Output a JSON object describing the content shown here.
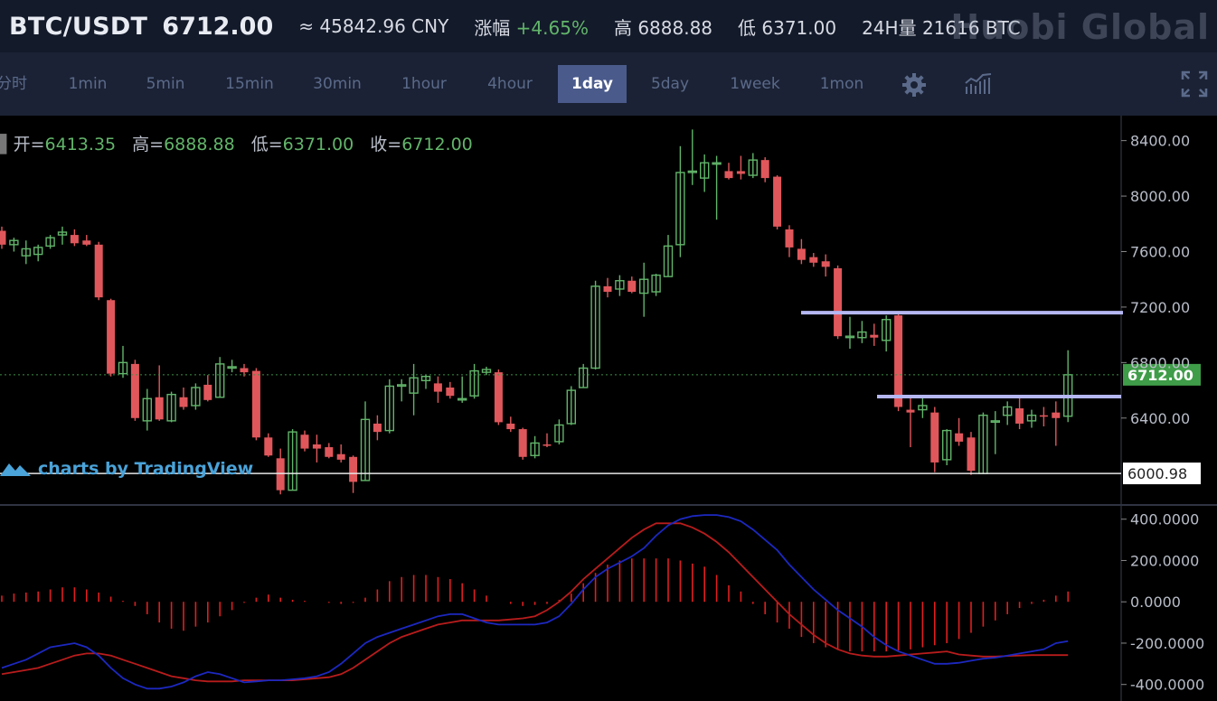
{
  "header": {
    "pair": "BTC/USDT",
    "price": "6712.00",
    "cny_label": "≈ 45842.96 CNY",
    "change_label": "涨幅",
    "change_value": "+4.65%",
    "high_label": "高 6888.88",
    "low_label": "低 6371.00",
    "volume_label": "24H量 21616 BTC",
    "brand": "Huobi Global"
  },
  "toolbar": {
    "timeframes": [
      "分时",
      "1min",
      "5min",
      "15min",
      "30min",
      "1hour",
      "4hour",
      "1day",
      "5day",
      "1week",
      "1mon"
    ],
    "active": "1day",
    "icons": [
      "gear-icon",
      "indicator-icon",
      "fullscreen-icon"
    ]
  },
  "ohlc": {
    "open_label": "开=",
    "open": "6413.35",
    "high_label": "高=",
    "high": "6888.88",
    "low_label": "低=",
    "low": "6371.00",
    "close_label": "收=",
    "close": "6712.00"
  },
  "watermark": "charts by TradingView",
  "colors": {
    "up": "#62b46a",
    "down": "#e0575b",
    "macd_bar": "#e01e1e",
    "dif_line": "#1c28c0",
    "dea_line": "#b81c1c",
    "hline": "#b5b7f2",
    "last_price_bg": "#3f9c48"
  },
  "chart_data": [
    {
      "type": "candlestick",
      "title": "",
      "last_price": 6712.0,
      "last_price_label": "6712.00",
      "marked_level": 6000.98,
      "marked_level_label": "6000.98",
      "horizontal_lines": [
        7160,
        6555
      ],
      "y_ticks": [
        8400,
        8000,
        7600,
        7200,
        6800,
        6400
      ],
      "y_tick_labels": [
        "8400.00",
        "8000.00",
        "7600.00",
        "7200.00",
        "6800.00",
        "6400.00"
      ],
      "ylim": [
        5780,
        8580
      ],
      "candles": [
        {
          "o": 7750,
          "h": 7780,
          "l": 7620,
          "c": 7650
        },
        {
          "o": 7650,
          "h": 7700,
          "l": 7600,
          "c": 7680
        },
        {
          "o": 7570,
          "h": 7680,
          "l": 7510,
          "c": 7620
        },
        {
          "o": 7580,
          "h": 7650,
          "l": 7530,
          "c": 7630
        },
        {
          "o": 7640,
          "h": 7720,
          "l": 7620,
          "c": 7700
        },
        {
          "o": 7720,
          "h": 7780,
          "l": 7650,
          "c": 7740
        },
        {
          "o": 7720,
          "h": 7760,
          "l": 7640,
          "c": 7660
        },
        {
          "o": 7680,
          "h": 7720,
          "l": 7640,
          "c": 7650
        },
        {
          "o": 7650,
          "h": 7670,
          "l": 7250,
          "c": 7270
        },
        {
          "o": 7250,
          "h": 7260,
          "l": 6700,
          "c": 6720
        },
        {
          "o": 6720,
          "h": 6920,
          "l": 6690,
          "c": 6800
        },
        {
          "o": 6790,
          "h": 6820,
          "l": 6380,
          "c": 6400
        },
        {
          "o": 6380,
          "h": 6610,
          "l": 6310,
          "c": 6540
        },
        {
          "o": 6550,
          "h": 6780,
          "l": 6380,
          "c": 6390
        },
        {
          "o": 6380,
          "h": 6590,
          "l": 6370,
          "c": 6570
        },
        {
          "o": 6550,
          "h": 6620,
          "l": 6460,
          "c": 6480
        },
        {
          "o": 6490,
          "h": 6650,
          "l": 6460,
          "c": 6620
        },
        {
          "o": 6640,
          "h": 6710,
          "l": 6520,
          "c": 6530
        },
        {
          "o": 6550,
          "h": 6840,
          "l": 6550,
          "c": 6790
        },
        {
          "o": 6760,
          "h": 6820,
          "l": 6730,
          "c": 6770
        },
        {
          "o": 6760,
          "h": 6790,
          "l": 6700,
          "c": 6730
        },
        {
          "o": 6740,
          "h": 6760,
          "l": 6240,
          "c": 6260
        },
        {
          "o": 6260,
          "h": 6290,
          "l": 6120,
          "c": 6130
        },
        {
          "o": 6110,
          "h": 6180,
          "l": 5850,
          "c": 5880
        },
        {
          "o": 5880,
          "h": 6320,
          "l": 5880,
          "c": 6300
        },
        {
          "o": 6280,
          "h": 6310,
          "l": 6160,
          "c": 6180
        },
        {
          "o": 6210,
          "h": 6280,
          "l": 6080,
          "c": 6180
        },
        {
          "o": 6190,
          "h": 6220,
          "l": 6110,
          "c": 6120
        },
        {
          "o": 6140,
          "h": 6210,
          "l": 6080,
          "c": 6100
        },
        {
          "o": 6120,
          "h": 6130,
          "l": 5860,
          "c": 5940
        },
        {
          "o": 5950,
          "h": 6520,
          "l": 5950,
          "c": 6390
        },
        {
          "o": 6360,
          "h": 6420,
          "l": 6240,
          "c": 6300
        },
        {
          "o": 6310,
          "h": 6680,
          "l": 6290,
          "c": 6630
        },
        {
          "o": 6630,
          "h": 6680,
          "l": 6520,
          "c": 6640
        },
        {
          "o": 6580,
          "h": 6790,
          "l": 6420,
          "c": 6690
        },
        {
          "o": 6670,
          "h": 6710,
          "l": 6610,
          "c": 6700
        },
        {
          "o": 6650,
          "h": 6700,
          "l": 6510,
          "c": 6590
        },
        {
          "o": 6620,
          "h": 6660,
          "l": 6540,
          "c": 6560
        },
        {
          "o": 6540,
          "h": 6700,
          "l": 6510,
          "c": 6540
        },
        {
          "o": 6560,
          "h": 6790,
          "l": 6540,
          "c": 6740
        },
        {
          "o": 6730,
          "h": 6770,
          "l": 6710,
          "c": 6750
        },
        {
          "o": 6730,
          "h": 6750,
          "l": 6350,
          "c": 6370
        },
        {
          "o": 6360,
          "h": 6410,
          "l": 6300,
          "c": 6320
        },
        {
          "o": 6320,
          "h": 6330,
          "l": 6100,
          "c": 6120
        },
        {
          "o": 6130,
          "h": 6270,
          "l": 6110,
          "c": 6220
        },
        {
          "o": 6210,
          "h": 6290,
          "l": 6190,
          "c": 6200
        },
        {
          "o": 6230,
          "h": 6390,
          "l": 6210,
          "c": 6350
        },
        {
          "o": 6360,
          "h": 6630,
          "l": 6350,
          "c": 6600
        },
        {
          "o": 6620,
          "h": 6790,
          "l": 6620,
          "c": 6760
        },
        {
          "o": 6760,
          "h": 7390,
          "l": 6750,
          "c": 7350
        },
        {
          "o": 7350,
          "h": 7410,
          "l": 7270,
          "c": 7310
        },
        {
          "o": 7330,
          "h": 7430,
          "l": 7280,
          "c": 7390
        },
        {
          "o": 7390,
          "h": 7420,
          "l": 7300,
          "c": 7310
        },
        {
          "o": 7300,
          "h": 7520,
          "l": 7130,
          "c": 7400
        },
        {
          "o": 7310,
          "h": 7440,
          "l": 7280,
          "c": 7430
        },
        {
          "o": 7420,
          "h": 7720,
          "l": 7420,
          "c": 7640
        },
        {
          "o": 7650,
          "h": 8360,
          "l": 7560,
          "c": 8170
        },
        {
          "o": 8180,
          "h": 8480,
          "l": 8080,
          "c": 8180
        },
        {
          "o": 8130,
          "h": 8300,
          "l": 8030,
          "c": 8240
        },
        {
          "o": 8240,
          "h": 8290,
          "l": 7830,
          "c": 8240
        },
        {
          "o": 8180,
          "h": 8240,
          "l": 8120,
          "c": 8130
        },
        {
          "o": 8180,
          "h": 8290,
          "l": 8120,
          "c": 8160
        },
        {
          "o": 8150,
          "h": 8310,
          "l": 8130,
          "c": 8260
        },
        {
          "o": 8260,
          "h": 8280,
          "l": 8100,
          "c": 8130
        },
        {
          "o": 8140,
          "h": 8150,
          "l": 7760,
          "c": 7780
        },
        {
          "o": 7760,
          "h": 7790,
          "l": 7560,
          "c": 7630
        },
        {
          "o": 7620,
          "h": 7690,
          "l": 7510,
          "c": 7540
        },
        {
          "o": 7560,
          "h": 7590,
          "l": 7490,
          "c": 7520
        },
        {
          "o": 7530,
          "h": 7580,
          "l": 7420,
          "c": 7490
        },
        {
          "o": 7480,
          "h": 7500,
          "l": 6970,
          "c": 6990
        },
        {
          "o": 6990,
          "h": 7130,
          "l": 6900,
          "c": 6990
        },
        {
          "o": 6980,
          "h": 7100,
          "l": 6940,
          "c": 7020
        },
        {
          "o": 7000,
          "h": 7080,
          "l": 6920,
          "c": 6980
        },
        {
          "o": 6960,
          "h": 7140,
          "l": 6880,
          "c": 7110
        },
        {
          "o": 7140,
          "h": 7150,
          "l": 6450,
          "c": 6480
        },
        {
          "o": 6460,
          "h": 6560,
          "l": 6190,
          "c": 6440
        },
        {
          "o": 6460,
          "h": 6560,
          "l": 6400,
          "c": 6490
        },
        {
          "o": 6440,
          "h": 6480,
          "l": 6010,
          "c": 6080
        },
        {
          "o": 6100,
          "h": 6320,
          "l": 6060,
          "c": 6310
        },
        {
          "o": 6290,
          "h": 6400,
          "l": 6200,
          "c": 6230
        },
        {
          "o": 6260,
          "h": 6300,
          "l": 5990,
          "c": 6020
        },
        {
          "o": 6000,
          "h": 6440,
          "l": 6000,
          "c": 6420
        },
        {
          "o": 6380,
          "h": 6450,
          "l": 6140,
          "c": 6380
        },
        {
          "o": 6420,
          "h": 6520,
          "l": 6350,
          "c": 6480
        },
        {
          "o": 6470,
          "h": 6550,
          "l": 6320,
          "c": 6360
        },
        {
          "o": 6380,
          "h": 6460,
          "l": 6330,
          "c": 6420
        },
        {
          "o": 6420,
          "h": 6480,
          "l": 6340,
          "c": 6410
        },
        {
          "o": 6440,
          "h": 6520,
          "l": 6200,
          "c": 6400
        },
        {
          "o": 6413.35,
          "h": 6888.88,
          "l": 6371,
          "c": 6712
        }
      ]
    },
    {
      "type": "macd",
      "y_ticks": [
        400,
        200,
        0,
        -200,
        -400
      ],
      "y_tick_labels": [
        "400.0000",
        "200.0000",
        "0.0000",
        "-200.0000",
        "-400.0000"
      ],
      "ylim": [
        -480,
        460
      ],
      "histogram": [
        30,
        40,
        45,
        50,
        60,
        70,
        70,
        60,
        45,
        25,
        5,
        -20,
        -60,
        -100,
        -130,
        -140,
        -120,
        -100,
        -70,
        -40,
        -5,
        20,
        35,
        20,
        10,
        5,
        0,
        -5,
        -10,
        -5,
        20,
        60,
        100,
        120,
        130,
        130,
        120,
        110,
        90,
        60,
        30,
        0,
        -10,
        -20,
        -15,
        -10,
        10,
        40,
        90,
        140,
        180,
        200,
        210,
        210,
        210,
        210,
        200,
        185,
        170,
        130,
        80,
        50,
        -10,
        -60,
        -100,
        -130,
        -170,
        -200,
        -220,
        -230,
        -240,
        -240,
        -240,
        -240,
        -235,
        -230,
        -220,
        -210,
        -200,
        -180,
        -150,
        -120,
        -90,
        -60,
        -30,
        -10,
        10,
        30,
        50
      ],
      "dif": [
        -320,
        -300,
        -280,
        -250,
        -220,
        -210,
        -200,
        -220,
        -260,
        -320,
        -370,
        -400,
        -420,
        -420,
        -410,
        -390,
        -360,
        -340,
        -350,
        -370,
        -390,
        -385,
        -380,
        -380,
        -375,
        -370,
        -360,
        -340,
        -300,
        -250,
        -200,
        -170,
        -150,
        -130,
        -110,
        -90,
        -70,
        -60,
        -60,
        -80,
        -100,
        -110,
        -110,
        -110,
        -110,
        -100,
        -70,
        -10,
        60,
        120,
        160,
        190,
        220,
        260,
        320,
        370,
        400,
        415,
        420,
        420,
        410,
        390,
        350,
        300,
        250,
        180,
        120,
        60,
        10,
        -40,
        -80,
        -120,
        -170,
        -210,
        -240,
        -260,
        -280,
        -300,
        -300,
        -295,
        -285,
        -275,
        -270,
        -260,
        -250,
        -240,
        -230,
        -200,
        -190
      ],
      "dea": [
        -350,
        -340,
        -330,
        -320,
        -300,
        -280,
        -260,
        -250,
        -250,
        -260,
        -280,
        -300,
        -320,
        -340,
        -360,
        -370,
        -380,
        -385,
        -385,
        -385,
        -380,
        -380,
        -380,
        -380,
        -380,
        -375,
        -370,
        -365,
        -350,
        -320,
        -280,
        -240,
        -200,
        -170,
        -150,
        -130,
        -110,
        -100,
        -90,
        -90,
        -90,
        -90,
        -85,
        -80,
        -70,
        -40,
        0,
        50,
        110,
        160,
        210,
        260,
        310,
        350,
        380,
        380,
        380,
        360,
        330,
        290,
        240,
        180,
        120,
        60,
        0,
        -60,
        -110,
        -160,
        -200,
        -230,
        -250,
        -260,
        -265,
        -265,
        -260,
        -255,
        -250,
        -245,
        -240,
        -255,
        -260,
        -265,
        -265,
        -262,
        -260,
        -258,
        -258,
        -258,
        -258
      ]
    }
  ]
}
